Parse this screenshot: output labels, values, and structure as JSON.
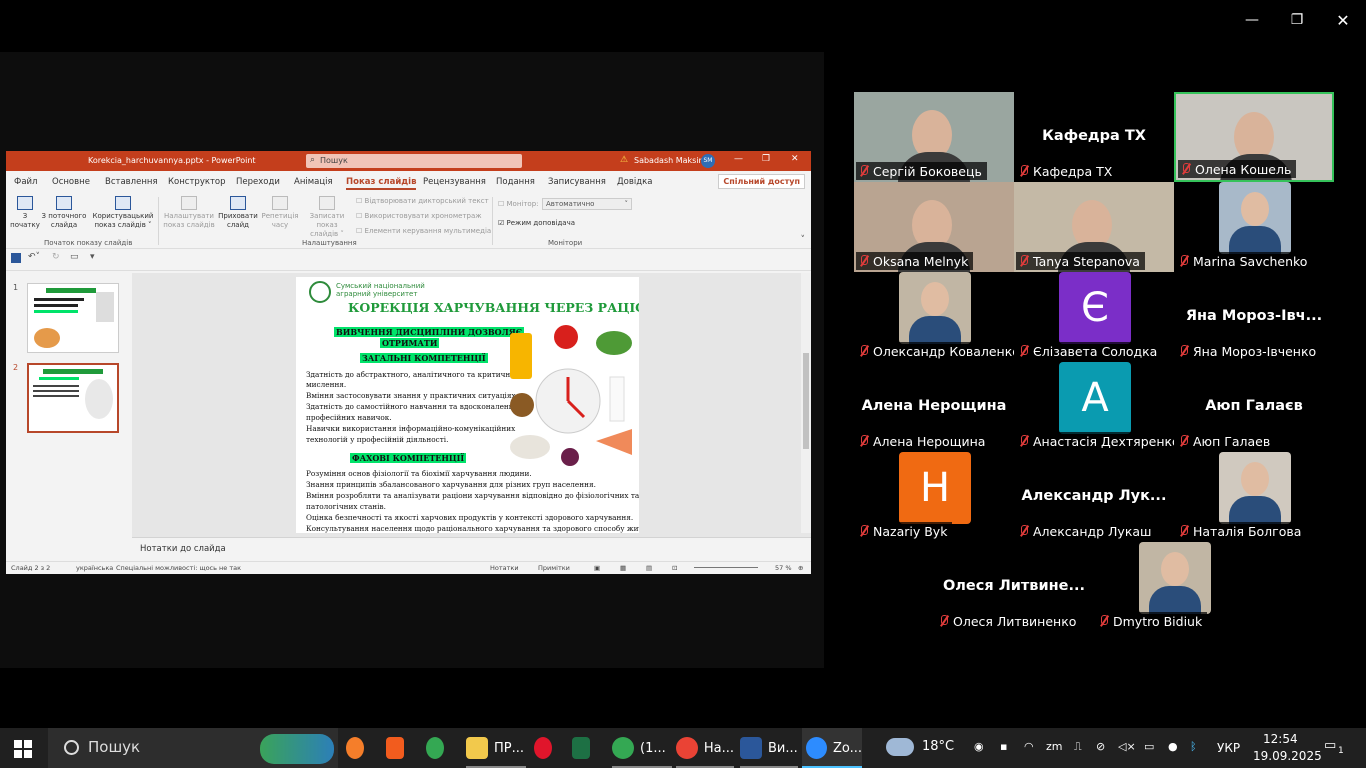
{
  "window": {
    "minimize_glyph": "—",
    "restore_glyph": "❐",
    "close_glyph": "✕"
  },
  "ppt": {
    "title": "Korekcia_harchuvannya.pptx - PowerPoint",
    "search": "Пошук",
    "user": "Sabadash Maksim",
    "user_initials": "SM",
    "menu": [
      "Файл",
      "Основне",
      "Вставлення",
      "Конструктор",
      "Переходи",
      "Анімація",
      "Показ слайдів",
      "Рецензування",
      "Подання",
      "Записування",
      "Довідка"
    ],
    "share": "Спільний доступ",
    "ribbon": {
      "from_start_1": "З",
      "from_start_2": "початку",
      "from_current_1": "З поточного",
      "from_current_2": "слайда",
      "custom_1": "Користувацький",
      "custom_2": "показ слайдів ˅",
      "group1": "Початок показу слайдів",
      "setup_1": "Налаштувати",
      "setup_2": "показ слайдів",
      "hide_1": "Приховати",
      "hide_2": "слайд",
      "rehearse_1": "Репетиція",
      "rehearse_2": "часу",
      "record_1": "Записати показ",
      "record_2": "слайдів ˅",
      "chk1": "Відтворювати дикторський текст",
      "chk2": "Використовувати хронометраж",
      "chk3": "Елементи керування мультимедіа",
      "group2": "Налаштування",
      "monitor_label": "Монітор:",
      "monitor_value": "Автоматично",
      "presenter": "Режим доповідача",
      "group3": "Монітори"
    },
    "thumbs": [
      "1",
      "2"
    ],
    "slide": {
      "uni1": "Сумський національний",
      "uni2": "аграрний університет",
      "title": "КОРЕКЦІЯ ХАРЧУВАННЯ ЧЕРЕЗ РАЦІОН",
      "hl1": "ВИВЧЕННЯ ДИСЦИПЛІНИ ДОЗВОЛЯЄ",
      "hl2": "ОТРИМАТИ",
      "hl3": "ЗАГАЛЬНІ КОМПЕТЕНЦІЇ",
      "g1": "Здатність до абстрактного, аналітичного та критичного",
      "g2": "мислення.",
      "g3": "Вміння застосовувати знання у практичних ситуаціях.",
      "g4": "Здатність до самостійного навчання та вдосконалення",
      "g5": "професійних навичок.",
      "g6": "Навички використання інформаційно-комунікаційних",
      "g7": "технологій у професійній діяльності.",
      "hl4": "ФАХОВІ КОМПЕТЕНЦІЇ",
      "f1": "Розуміння основ фізіології та біохімії харчування людини.",
      "f2": "Знання принципів збалансованого харчування для різних груп населення.",
      "f3": "Вміння розробляти та аналізувати раціони харчування відповідно до фізіологічних та",
      "f4": "патологічних станів.",
      "f5": "Оцінка безпечності та якості харчових продуктів у контексті здорового харчування.",
      "f6": "Консультування населення щодо раціонального харчування та здорового способу життя."
    },
    "notes": "Нотатки до слайда",
    "status": {
      "slide": "Слайд 2 з 2",
      "lang": "українська",
      "access": "Спеціальні можливості: щось не так",
      "notes_btn": "Нотатки",
      "comments_btn": "Примітки",
      "zoom": "57 %"
    }
  },
  "participants": [
    {
      "name": "Сергій Боковець",
      "kind": "video"
    },
    {
      "name": "Кафедра ТХ",
      "kind": "text",
      "big": "Кафедра ТХ"
    },
    {
      "name": "Олена Кошель",
      "kind": "video",
      "active": true
    },
    {
      "name": "Oksana Melnyk",
      "kind": "video"
    },
    {
      "name": "Tanya Stepanova",
      "kind": "video"
    },
    {
      "name": "Marina Savchenko",
      "kind": "photo"
    },
    {
      "name": "Олександр Коваленко",
      "kind": "photo"
    },
    {
      "name": "Єлізавета Солодка",
      "kind": "letter",
      "letter": "Є",
      "color": "#7b2ec8"
    },
    {
      "name": "Яна Мороз-Івченко",
      "kind": "text",
      "big": "Яна  Мороз-Івч..."
    },
    {
      "name": "Алена Нерощина",
      "kind": "text",
      "big": "Алена Нерощина"
    },
    {
      "name": "Анастасія Дехтяренко",
      "kind": "letter",
      "letter": "А",
      "color": "#0a9bb0"
    },
    {
      "name": "Аюп Галаев",
      "kind": "text",
      "big": "Аюп Галаєв"
    },
    {
      "name": "Nazariy Byk",
      "kind": "letter",
      "letter": "Н",
      "color": "#f06a12"
    },
    {
      "name": "Александр Лукаш",
      "kind": "text",
      "big": "Александр  Лук..."
    },
    {
      "name": "Наталія Болгова",
      "kind": "photo"
    },
    {
      "name": "Олеся Литвиненко",
      "kind": "text",
      "big": "Олеся  Литвине..."
    },
    {
      "name": "Dmytro Bidiuk",
      "kind": "photo"
    }
  ],
  "taskbar": {
    "search": "Пошук",
    "apps": [
      {
        "label": "ПР...",
        "color": "#f2c94c"
      },
      {
        "label": "(1...",
        "color": "#34a853"
      },
      {
        "label": "На...",
        "color": "#ea4335"
      },
      {
        "label": "Ви...",
        "color": "#2b579a"
      },
      {
        "label": "Zo...",
        "color": "#2d8cff"
      }
    ],
    "weather": "18°C",
    "lang": "УКР",
    "time": "12:54",
    "date": "19.09.2025",
    "notif": "1"
  }
}
